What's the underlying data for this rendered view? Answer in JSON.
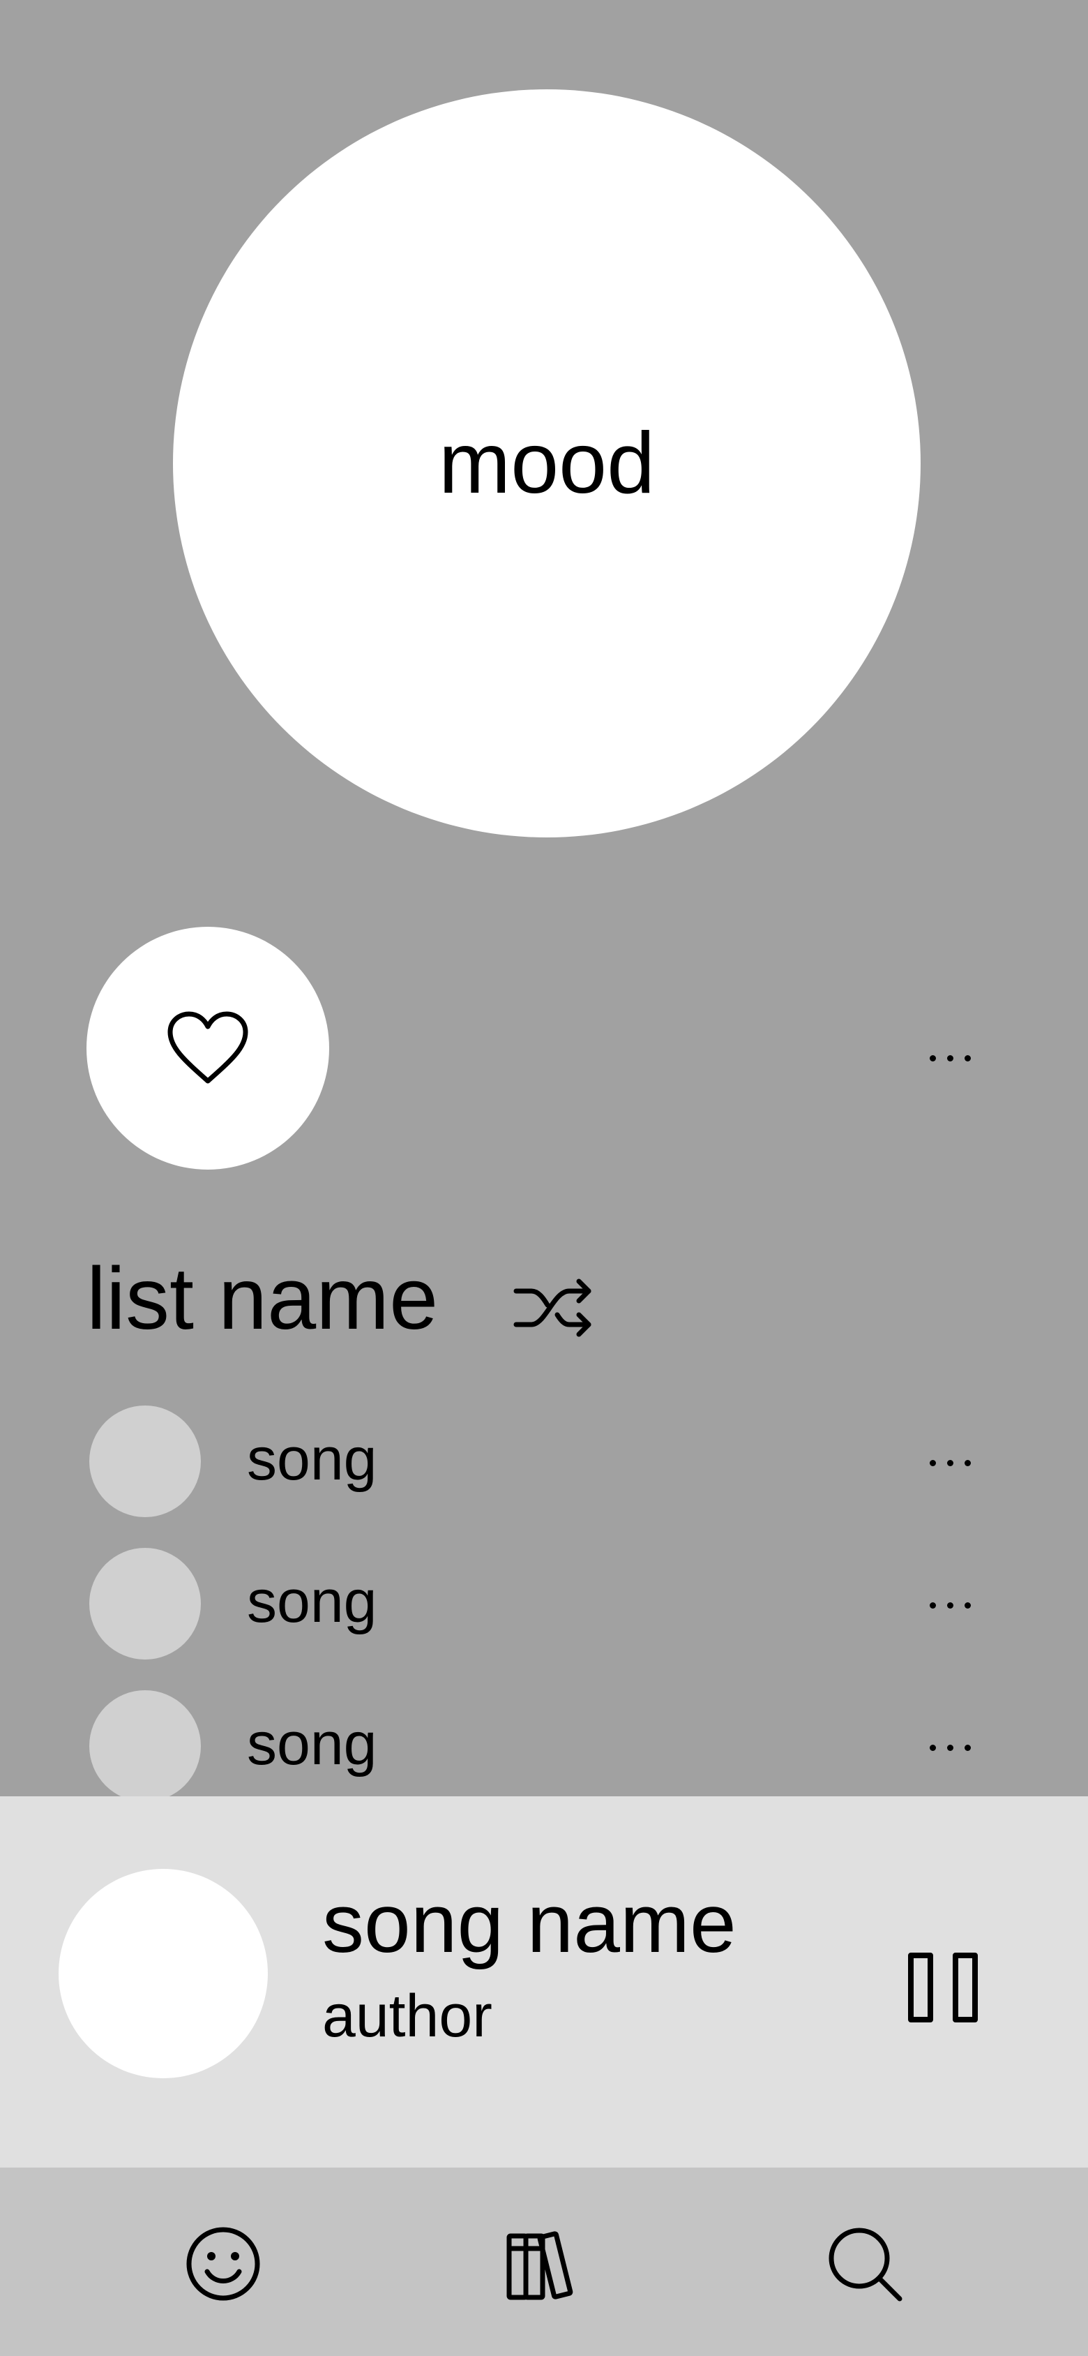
{
  "hero": {
    "mood_label": "mood"
  },
  "actions": {
    "like_icon": "heart-icon",
    "more_icon": "more-horizontal-icon"
  },
  "list": {
    "title": "list name",
    "shuffle_icon": "shuffle-icon",
    "songs": [
      {
        "label": "song"
      },
      {
        "label": "song"
      },
      {
        "label": "song"
      }
    ]
  },
  "player": {
    "song_name": "song name",
    "author": "author",
    "control_icon": "pause-icon"
  },
  "nav": {
    "items": [
      "smiley-icon",
      "library-icon",
      "search-icon"
    ]
  },
  "colors": {
    "background": "#a1a1a1",
    "player": "#e0e0e0",
    "nav": "#c4c4c4",
    "thumb": "#d0d0d0"
  }
}
